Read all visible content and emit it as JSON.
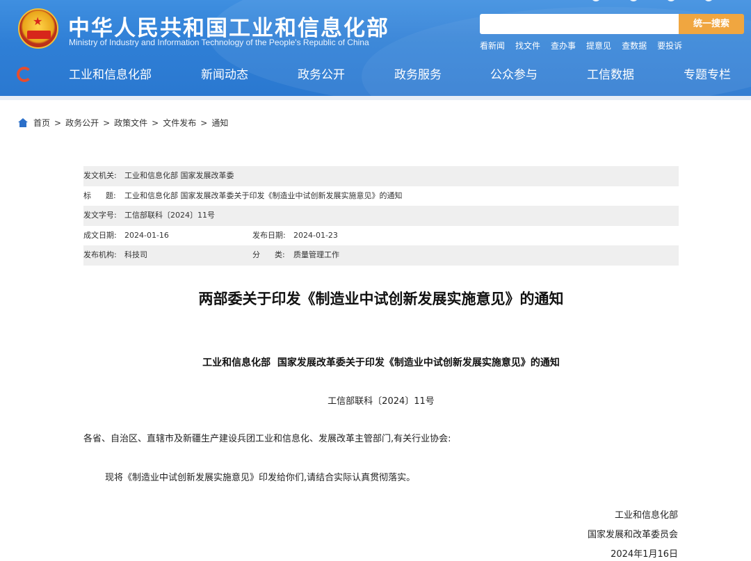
{
  "header": {
    "title": "中华人民共和国工业和信息化部",
    "subtitle": "Ministry of Industry and Information Technology of the People's Republic of China",
    "search_placeholder": "",
    "search_button": "统一搜索",
    "quick_links": [
      "看新闻",
      "找文件",
      "查办事",
      "提意见",
      "查数据",
      "要投诉"
    ],
    "brand_color": "#2f7fd6",
    "search_button_color": "#f0a640"
  },
  "nav": {
    "items": [
      "工业和信息化部",
      "新闻动态",
      "政务公开",
      "政务服务",
      "公众参与",
      "工信数据",
      "专题专栏"
    ]
  },
  "breadcrumb": {
    "items": [
      "首页",
      "政务公开",
      "政策文件",
      "文件发布",
      "通知"
    ],
    "separator": ">"
  },
  "meta": {
    "issuer_label": "发文机关:",
    "issuer": "工业和信息化部 国家发展改革委",
    "title_label": "标      题:",
    "title": "工业和信息化部 国家发展改革委关于印发《制造业中试创新发展实施意见》的通知",
    "docno_label": "发文字号:",
    "docno": "工信部联科〔2024〕11号",
    "created_label": "成文日期:",
    "created": "2024-01-16",
    "published_label": "发布日期:",
    "published": "2024-01-23",
    "org_label": "发布机构:",
    "org": "科技司",
    "category_label": "分      类:",
    "category": "质量管理工作"
  },
  "article": {
    "title": "两部委关于印发《制造业中试创新发展实施意见》的通知",
    "doc_title": "工业和信息化部  国家发展改革委关于印发《制造业中试创新发展实施意见》的通知",
    "doc_number": "工信部联科〔2024〕11号",
    "salutation": "各省、自治区、直辖市及新疆生产建设兵团工业和信息化、发展改革主管部门,有关行业协会:",
    "body": "现将《制造业中试创新发展实施意见》印发给你们,请结合实际认真贯彻落实。",
    "signatory_1": "工业和信息化部",
    "signatory_2": "国家发展和改革委员会",
    "date": "2024年1月16日"
  }
}
